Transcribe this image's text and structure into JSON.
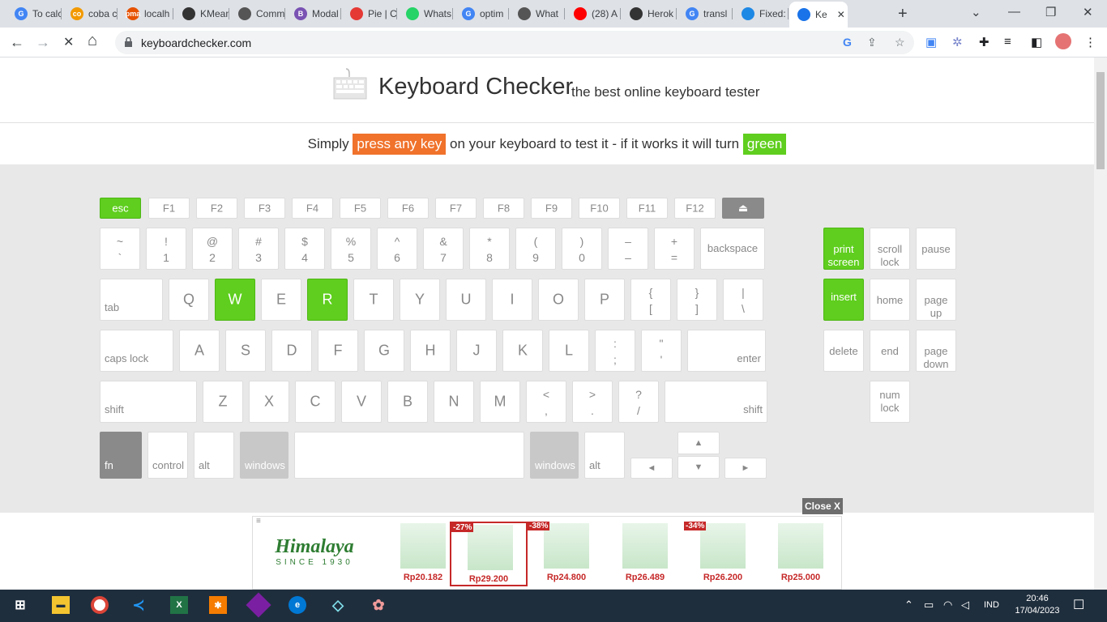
{
  "browser": {
    "tabs": [
      {
        "label": "To calc",
        "fav": "G",
        "color": "#4285f4"
      },
      {
        "label": "coba c",
        "fav": "co",
        "color": "#f29900"
      },
      {
        "label": "localh",
        "fav": "pma",
        "color": "#e65100"
      },
      {
        "label": "KMean",
        "fav": "",
        "color": "#333333"
      },
      {
        "label": "Comm",
        "fav": "",
        "color": "#555555"
      },
      {
        "label": "Modal",
        "fav": "B",
        "color": "#7952b3"
      },
      {
        "label": "Pie | C",
        "fav": "",
        "color": "#e53935"
      },
      {
        "label": "Whats",
        "fav": "",
        "color": "#25d366"
      },
      {
        "label": "optim",
        "fav": "G",
        "color": "#4285f4"
      },
      {
        "label": "What",
        "fav": "",
        "color": "#555555"
      },
      {
        "label": "(28) A",
        "fav": "",
        "color": "#ff0000"
      },
      {
        "label": "Herok",
        "fav": "",
        "color": "#333333"
      },
      {
        "label": "transl",
        "fav": "G",
        "color": "#4285f4"
      },
      {
        "label": "Fixed:",
        "fav": "",
        "color": "#1e88e5"
      },
      {
        "label": "Ke",
        "fav": "",
        "color": "#1a73e8"
      }
    ],
    "url": "keyboardchecker.com",
    "newtab": "+",
    "icons": {
      "back": "←",
      "forward": "→",
      "stop": "✕",
      "home": "⌂",
      "min": "—",
      "max": "❐",
      "close": "✕",
      "dropdown": "⌄"
    }
  },
  "page": {
    "title": "Keyboard Checker",
    "tagline": "the best online keyboard tester",
    "instr": {
      "pre": "Simply",
      "hl1": "press any key",
      "mid": "on your keyboard to test it - if it works it will turn",
      "hl2": "green",
      "hl1_color": "#f0722b",
      "hl2_color": "#5fce1e"
    },
    "keys": {
      "fn_row": [
        {
          "label": "esc",
          "state": "on"
        },
        {
          "label": "F1"
        },
        {
          "label": "F2"
        },
        {
          "label": "F3"
        },
        {
          "label": "F4"
        },
        {
          "label": "F5"
        },
        {
          "label": "F6"
        },
        {
          "label": "F7"
        },
        {
          "label": "F8"
        },
        {
          "label": "F9"
        },
        {
          "label": "F10"
        },
        {
          "label": "F11"
        },
        {
          "label": "F12"
        },
        {
          "label": "⏏",
          "state": "dark"
        }
      ],
      "num_row": [
        {
          "top": "~",
          "bot": "`"
        },
        {
          "top": "!",
          "bot": "1"
        },
        {
          "top": "@",
          "bot": "2"
        },
        {
          "top": "#",
          "bot": "3"
        },
        {
          "top": "$",
          "bot": "4"
        },
        {
          "top": "%",
          "bot": "5"
        },
        {
          "top": "^",
          "bot": "6"
        },
        {
          "top": "&",
          "bot": "7"
        },
        {
          "top": "*",
          "bot": "8"
        },
        {
          "top": "(",
          "bot": "9"
        },
        {
          "top": ")",
          "bot": "0"
        },
        {
          "top": "–",
          "bot": "–"
        },
        {
          "top": "+",
          "bot": "="
        },
        {
          "label": "backspace"
        }
      ],
      "tab_row": [
        {
          "label": "tab"
        },
        {
          "label": "Q"
        },
        {
          "label": "W",
          "state": "on"
        },
        {
          "label": "E"
        },
        {
          "label": "R",
          "state": "on"
        },
        {
          "label": "T"
        },
        {
          "label": "Y"
        },
        {
          "label": "U"
        },
        {
          "label": "I"
        },
        {
          "label": "O"
        },
        {
          "label": "P"
        },
        {
          "top": "{",
          "bot": "["
        },
        {
          "top": "}",
          "bot": "]"
        },
        {
          "top": "|",
          "bot": "\\"
        }
      ],
      "caps_row": [
        {
          "label": "caps lock"
        },
        {
          "label": "A"
        },
        {
          "label": "S"
        },
        {
          "label": "D"
        },
        {
          "label": "F"
        },
        {
          "label": "G"
        },
        {
          "label": "H"
        },
        {
          "label": "J"
        },
        {
          "label": "K"
        },
        {
          "label": "L"
        },
        {
          "top": ":",
          "bot": ";"
        },
        {
          "top": "\"",
          "bot": "'"
        },
        {
          "label": "enter"
        }
      ],
      "shift_row": [
        {
          "label": "shift"
        },
        {
          "label": "Z"
        },
        {
          "label": "X"
        },
        {
          "label": "C"
        },
        {
          "label": "V"
        },
        {
          "label": "B"
        },
        {
          "label": "N"
        },
        {
          "label": "M"
        },
        {
          "top": "<",
          "bot": ","
        },
        {
          "top": ">",
          "bot": "."
        },
        {
          "top": "?",
          "bot": "/"
        },
        {
          "label": "shift"
        }
      ],
      "bottom_row": [
        {
          "label": "fn",
          "state": "dark"
        },
        {
          "label": "control"
        },
        {
          "label": "alt"
        },
        {
          "label": "windows",
          "state": "dim"
        },
        {
          "label": ""
        },
        {
          "label": "windows",
          "state": "dim"
        },
        {
          "label": "alt"
        },
        {
          "label": "◄"
        },
        {
          "label": "▲"
        },
        {
          "label": "▼"
        },
        {
          "label": "►"
        }
      ],
      "nav_cluster": [
        {
          "label": "print screen",
          "state": "on"
        },
        {
          "label": "scroll lock"
        },
        {
          "label": "pause"
        },
        {
          "label": "insert",
          "state": "on"
        },
        {
          "label": "home"
        },
        {
          "label": "page up"
        },
        {
          "label": "delete"
        },
        {
          "label": "end"
        },
        {
          "label": "page down"
        },
        {
          "label": "num lock"
        }
      ]
    },
    "ad": {
      "close": "Close X",
      "brand": "Himalaya",
      "since": "SINCE 1930",
      "products": [
        {
          "price": "Rp20.182",
          "disc": ""
        },
        {
          "price": "Rp29.200",
          "disc": "-27%"
        },
        {
          "price": "Rp24.800",
          "disc": "-38%"
        },
        {
          "price": "Rp26.489",
          "disc": ""
        },
        {
          "price": "Rp26.200",
          "disc": "-34%"
        },
        {
          "price": "Rp25.000",
          "disc": ""
        }
      ]
    }
  },
  "taskbar": {
    "lang": "IND",
    "time": "20:46",
    "date": "17/04/2023"
  }
}
